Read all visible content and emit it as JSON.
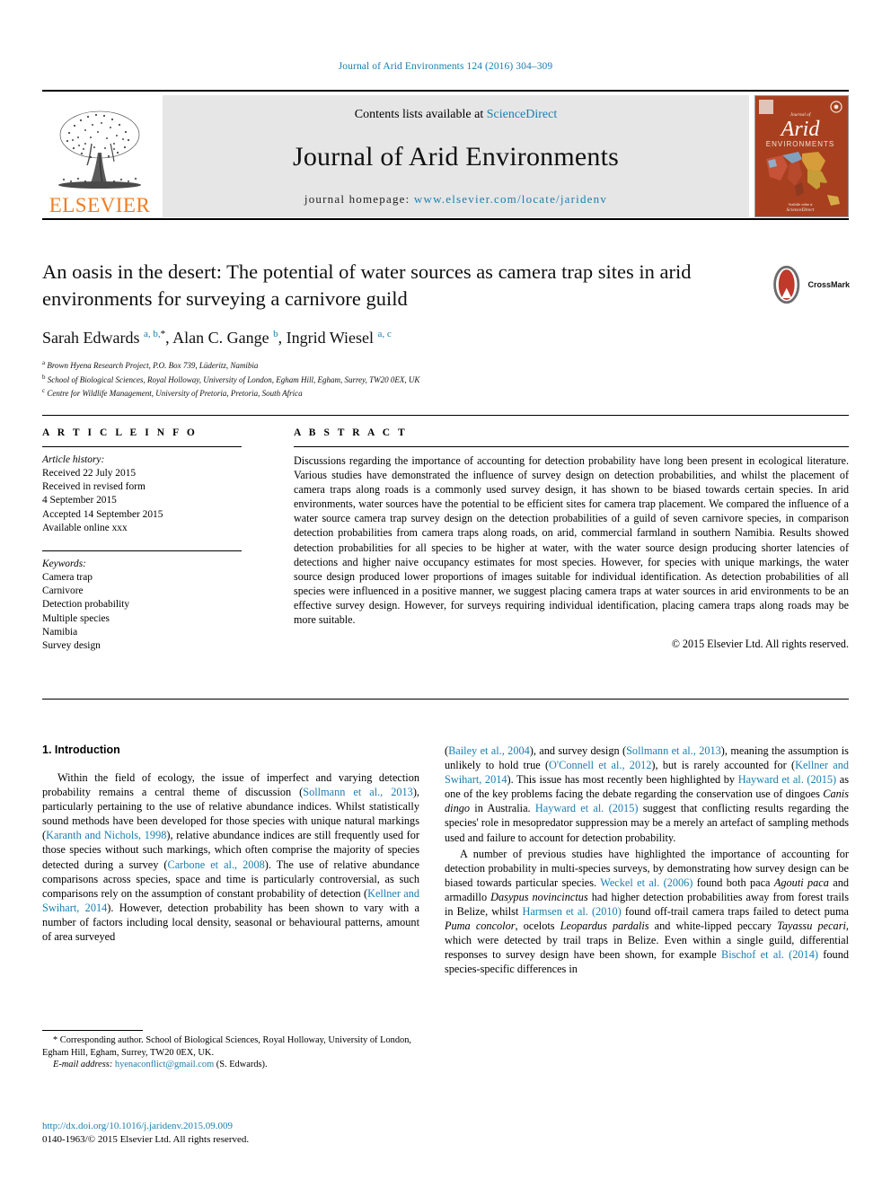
{
  "running_head": "Journal of Arid Environments 124 (2016) 304–309",
  "banner": {
    "contents_prefix": "Contents lists available at",
    "sciencedirect": "ScienceDirect",
    "journal_name": "Journal of Arid Environments",
    "homepage_prefix": "journal homepage:",
    "homepage_url": "www.elsevier.com/locate/jaridenv",
    "publisher_wordmark": "ELSEVIER",
    "cover": {
      "line1": "Journal of",
      "line2": "Arid",
      "line3": "ENVIRONMENTS",
      "footer": "ScienceDirect"
    }
  },
  "article": {
    "title": "An oasis in the desert: The potential of water sources as camera trap sites in arid environments for surveying a carnivore guild",
    "authors_html": "Sarah Edwards <sup class=\"aff-marker\">a, b,</sup><sup class=\"star\">*</sup>, Alan C. Gange <sup class=\"aff-marker\">b</sup>, Ingrid Wiesel <sup class=\"aff-marker\">a, c</sup>",
    "affiliations": [
      {
        "label": "a",
        "text": "Brown Hyena Research Project, P.O. Box 739, Lüderitz, Namibia"
      },
      {
        "label": "b",
        "text": "School of Biological Sciences, Royal Holloway, University of London, Egham Hill, Egham, Surrey, TW20 0EX, UK"
      },
      {
        "label": "c",
        "text": "Centre for Wildlife Management, University of Pretoria, Pretoria, South Africa"
      }
    ],
    "crossmark_label": "CrossMark"
  },
  "article_info": {
    "heading": "A R T I C L E   I N F O",
    "history_label": "Article history:",
    "history": [
      "Received 22 July 2015",
      "Received in revised form",
      "4 September 2015",
      "Accepted 14 September 2015",
      "Available online xxx"
    ],
    "keywords_label": "Keywords:",
    "keywords": [
      "Camera trap",
      "Carnivore",
      "Detection probability",
      "Multiple species",
      "Namibia",
      "Survey design"
    ]
  },
  "abstract": {
    "heading": "A B S T R A C T",
    "text": "Discussions regarding the importance of accounting for detection probability have long been present in ecological literature. Various studies have demonstrated the influence of survey design on detection probabilities, and whilst the placement of camera traps along roads is a commonly used survey design, it has shown to be biased towards certain species. In arid environments, water sources have the potential to be efficient sites for camera trap placement. We compared the influence of a water source camera trap survey design on the detection probabilities of a guild of seven carnivore species, in comparison detection probabilities from camera traps along roads, on arid, commercial farmland in southern Namibia. Results showed detection probabilities for all species to be higher at water, with the water source design producing shorter latencies of detections and higher naive occupancy estimates for most species. However, for species with unique markings, the water source design produced lower proportions of images suitable for individual identification. As detection probabilities of all species were influenced in a positive manner, we suggest placing camera traps at water sources in arid environments to be an effective survey design. However, for surveys requiring individual identification, placing camera traps along roads may be more suitable.",
    "copyright": "© 2015 Elsevier Ltd. All rights reserved."
  },
  "introduction": {
    "heading": "1. Introduction",
    "left_paragraph_html": "Within the field of ecology, the issue of imperfect and varying detection probability remains a central theme of discussion (<span class=\"ref\">Sollmann et al., 2013</span>), particularly pertaining to the use of relative abundance indices. Whilst statistically sound methods have been developed for those species with unique natural markings (<span class=\"ref\">Karanth and Nichols, 1998</span>), relative abundance indices are still frequently used for those species without such markings, which often comprise the majority of species detected during a survey (<span class=\"ref\">Carbone et al., 2008</span>). The use of relative abundance comparisons across species, space and time is particularly controversial, as such comparisons rely on the assumption of constant probability of detection (<span class=\"ref\">Kellner and Swihart, 2014</span>). However, detection probability has been shown to vary with a number of factors including local density, seasonal or behavioural patterns, amount of area surveyed",
    "right_paragraph_1_html": "(<span class=\"ref\">Bailey et al., 2004</span>), and survey design (<span class=\"ref\">Sollmann et al., 2013</span>), meaning the assumption is unlikely to hold true (<span class=\"ref\">O'Connell et al., 2012</span>), but is rarely accounted for (<span class=\"ref\">Kellner and Swihart, 2014</span>). This issue has most recently been highlighted by <span class=\"ref\">Hayward et al. (2015)</span> as one of the key problems facing the debate regarding the conservation use of dingoes <span class=\"ital\">Canis dingo</span> in Australia. <span class=\"ref\">Hayward et al. (2015)</span> suggest that conflicting results regarding the species' role in mesopredator suppression may be a merely an artefact of sampling methods used and failure to account for detection probability.",
    "right_paragraph_2_html": "A number of previous studies have highlighted the importance of accounting for detection probability in multi-species surveys, by demonstrating how survey design can be biased towards particular species. <span class=\"ref\">Weckel et al. (2006)</span> found both paca <span class=\"ital\">Agouti paca</span> and armadillo <span class=\"ital\">Dasypus novincinctus</span> had higher detection probabilities away from forest trails in Belize, whilst <span class=\"ref\">Harmsen et al. (2010)</span> found off-trail camera traps failed to detect puma <span class=\"ital\">Puma concolor</span>, ocelots <span class=\"ital\">Leopardus pardalis</span> and white-lipped peccary <span class=\"ital\">Tayassu pecari</span>, which were detected by trail traps in Belize. Even within a single guild, differential responses to survey design have been shown, for example <span class=\"ref\">Bischof et al. (2014)</span> found species-specific differences in"
  },
  "footnote": {
    "corresponding_html": "* Corresponding author. School of Biological Sciences, Royal Holloway, University of London, Egham Hill, Egham, Surrey, TW20 0EX, UK.",
    "email_label": "E-mail address:",
    "email": "hyenaconflict@gmail.com",
    "email_suffix": "(S. Edwards)."
  },
  "footer": {
    "doi": "http://dx.doi.org/10.1016/j.jaridenv.2015.09.009",
    "issn_line": "0140-1963/© 2015 Elsevier Ltd. All rights reserved."
  },
  "colors": {
    "link": "#1a7eb0",
    "elsevier_orange": "#ef7d22",
    "banner_grey": "#e6e6e6",
    "cover_red": "#a8401f",
    "crossmark_red": "#c0392b"
  }
}
